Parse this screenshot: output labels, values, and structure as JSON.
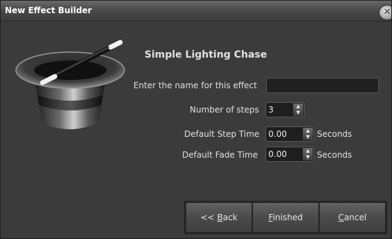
{
  "window": {
    "title": "New Effect Builder",
    "close_glyph": "✕"
  },
  "heading": "Simple Lighting Chase",
  "form": {
    "name_label": "Enter the name for this effect",
    "name_value": "",
    "steps_label": "Number of steps",
    "steps_value": "3",
    "step_time_label": "Default Step Time",
    "step_time_value": "0.00",
    "step_time_unit": "Seconds",
    "fade_time_label": "Default Fade Time",
    "fade_time_value": "0.00",
    "fade_time_unit": "Seconds"
  },
  "buttons": {
    "back_prefix": "<< ",
    "back_mnemonic": "B",
    "back_rest": "ack",
    "finished_mnemonic": "F",
    "finished_rest": "inished",
    "cancel_mnemonic": "C",
    "cancel_rest": "ancel"
  },
  "icons": {
    "hat": "magic-hat-icon",
    "close": "close-icon",
    "spin_up": "chevron-up-icon",
    "spin_down": "chevron-down-icon"
  }
}
